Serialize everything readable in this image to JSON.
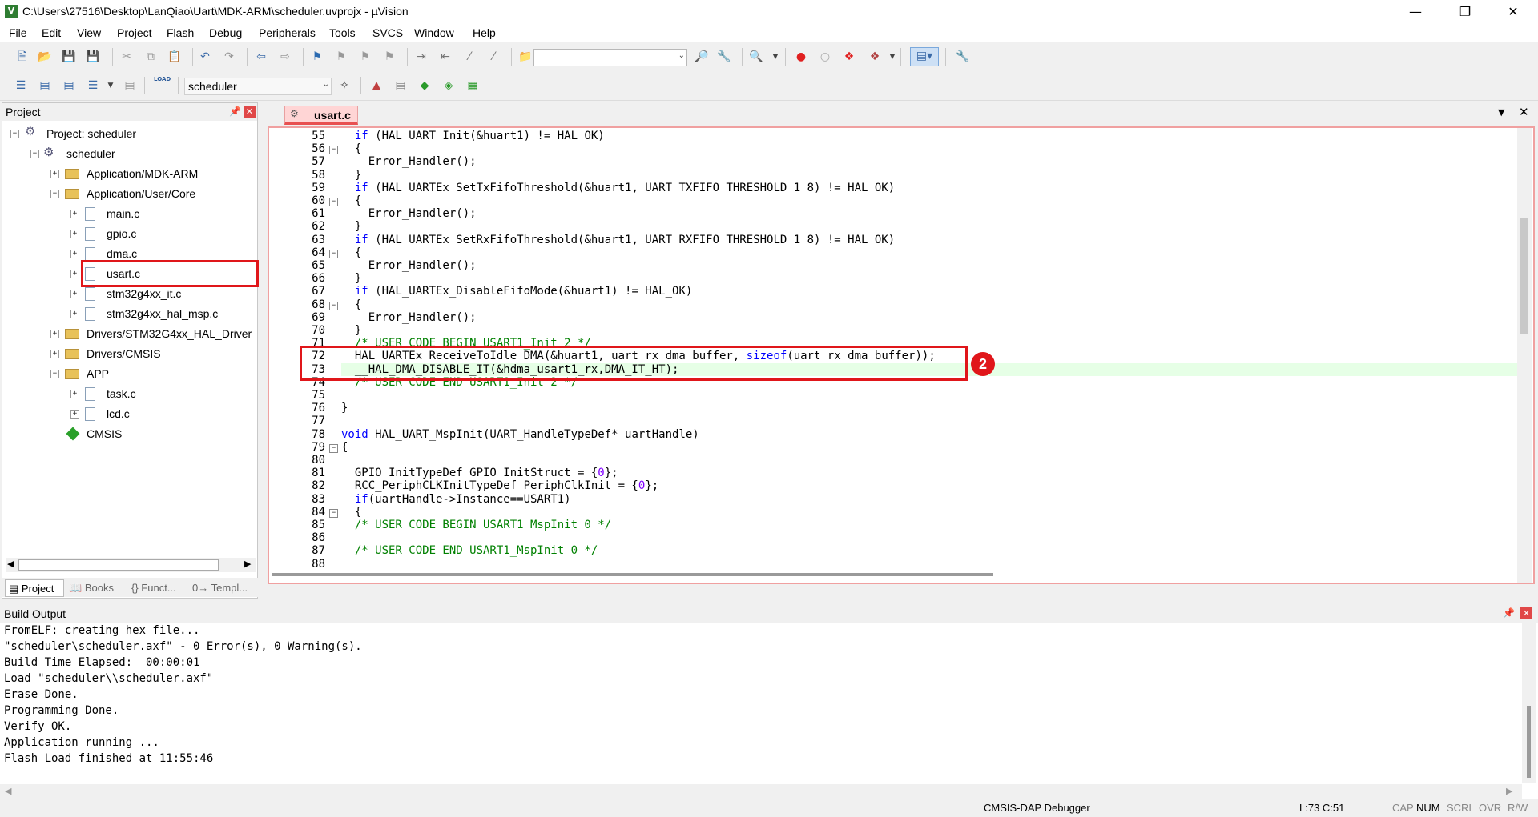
{
  "window": {
    "title": "C:\\Users\\27516\\Desktop\\LanQiao\\Uart\\MDK-ARM\\scheduler.uvprojx - µVision",
    "icon_letter": "V"
  },
  "menu": [
    "File",
    "Edit",
    "View",
    "Project",
    "Flash",
    "Debug",
    "Peripherals",
    "Tools",
    "SVCS",
    "Window",
    "Help"
  ],
  "toolbar2": {
    "target_value": "scheduler",
    "load_label": "LOAD"
  },
  "project_pane": {
    "title": "Project",
    "tree": [
      {
        "label": "Project: scheduler"
      },
      {
        "label": "scheduler"
      },
      {
        "label": "Application/MDK-ARM"
      },
      {
        "label": "Application/User/Core"
      },
      {
        "label": "main.c"
      },
      {
        "label": "gpio.c"
      },
      {
        "label": "dma.c"
      },
      {
        "label": "usart.c"
      },
      {
        "label": "stm32g4xx_it.c"
      },
      {
        "label": "stm32g4xx_hal_msp.c"
      },
      {
        "label": "Drivers/STM32G4xx_HAL_Driver"
      },
      {
        "label": "Drivers/CMSIS"
      },
      {
        "label": "APP"
      },
      {
        "label": "task.c"
      },
      {
        "label": "lcd.c"
      },
      {
        "label": "CMSIS"
      }
    ],
    "tabs": [
      "Project",
      "Books",
      "{} Funct...",
      "0→ Templ..."
    ]
  },
  "editor": {
    "tab_label": "usart.c",
    "badge": "2",
    "lines": [
      {
        "n": "55",
        "t": "  if (HAL_UART_Init(&huart1) != HAL_OK)"
      },
      {
        "n": "56",
        "t": "  {"
      },
      {
        "n": "57",
        "t": "    Error_Handler();"
      },
      {
        "n": "58",
        "t": "  }"
      },
      {
        "n": "59",
        "t": "  if (HAL_UARTEx_SetTxFifoThreshold(&huart1, UART_TXFIFO_THRESHOLD_1_8) != HAL_OK)"
      },
      {
        "n": "60",
        "t": "  {"
      },
      {
        "n": "61",
        "t": "    Error_Handler();"
      },
      {
        "n": "62",
        "t": "  }"
      },
      {
        "n": "63",
        "t": "  if (HAL_UARTEx_SetRxFifoThreshold(&huart1, UART_RXFIFO_THRESHOLD_1_8) != HAL_OK)"
      },
      {
        "n": "64",
        "t": "  {"
      },
      {
        "n": "65",
        "t": "    Error_Handler();"
      },
      {
        "n": "66",
        "t": "  }"
      },
      {
        "n": "67",
        "t": "  if (HAL_UARTEx_DisableFifoMode(&huart1) != HAL_OK)"
      },
      {
        "n": "68",
        "t": "  {"
      },
      {
        "n": "69",
        "t": "    Error_Handler();"
      },
      {
        "n": "70",
        "t": "  }"
      },
      {
        "n": "71",
        "t": "  /* USER CODE BEGIN USART1_Init 2 */"
      },
      {
        "n": "72",
        "t": "  HAL_UARTEx_ReceiveToIdle_DMA(&huart1, uart_rx_dma_buffer, sizeof(uart_rx_dma_buffer));"
      },
      {
        "n": "73",
        "t": "  __HAL_DMA_DISABLE_IT(&hdma_usart1_rx,DMA_IT_HT);"
      },
      {
        "n": "74",
        "t": "  /* USER CODE END USART1_Init 2 */"
      },
      {
        "n": "75",
        "t": ""
      },
      {
        "n": "76",
        "t": "}"
      },
      {
        "n": "77",
        "t": ""
      },
      {
        "n": "78",
        "t": "void HAL_UART_MspInit(UART_HandleTypeDef* uartHandle)"
      },
      {
        "n": "79",
        "t": "{"
      },
      {
        "n": "80",
        "t": ""
      },
      {
        "n": "81",
        "t": "  GPIO_InitTypeDef GPIO_InitStruct = {0};"
      },
      {
        "n": "82",
        "t": "  RCC_PeriphCLKInitTypeDef PeriphClkInit = {0};"
      },
      {
        "n": "83",
        "t": "  if(uartHandle->Instance==USART1)"
      },
      {
        "n": "84",
        "t": "  {"
      },
      {
        "n": "85",
        "t": "  /* USER CODE BEGIN USART1_MspInit 0 */"
      },
      {
        "n": "86",
        "t": ""
      },
      {
        "n": "87",
        "t": "  /* USER CODE END USART1_MspInit 0 */"
      },
      {
        "n": "88",
        "t": ""
      }
    ]
  },
  "build_output": {
    "title": "Build Output",
    "lines": [
      "FromELF: creating hex file...",
      "\"scheduler\\scheduler.axf\" - 0 Error(s), 0 Warning(s).",
      "Build Time Elapsed:  00:00:01",
      "Load \"scheduler\\\\scheduler.axf\"",
      "Erase Done.",
      "Programming Done.",
      "Verify OK.",
      "Application running ...",
      "Flash Load finished at 11:55:46"
    ]
  },
  "status": {
    "debugger": "CMSIS-DAP Debugger",
    "position": "L:73 C:51",
    "cap": "CAP",
    "num": "NUM",
    "scrl": "SCRL",
    "ovr": "OVR",
    "rw": "R/W"
  }
}
